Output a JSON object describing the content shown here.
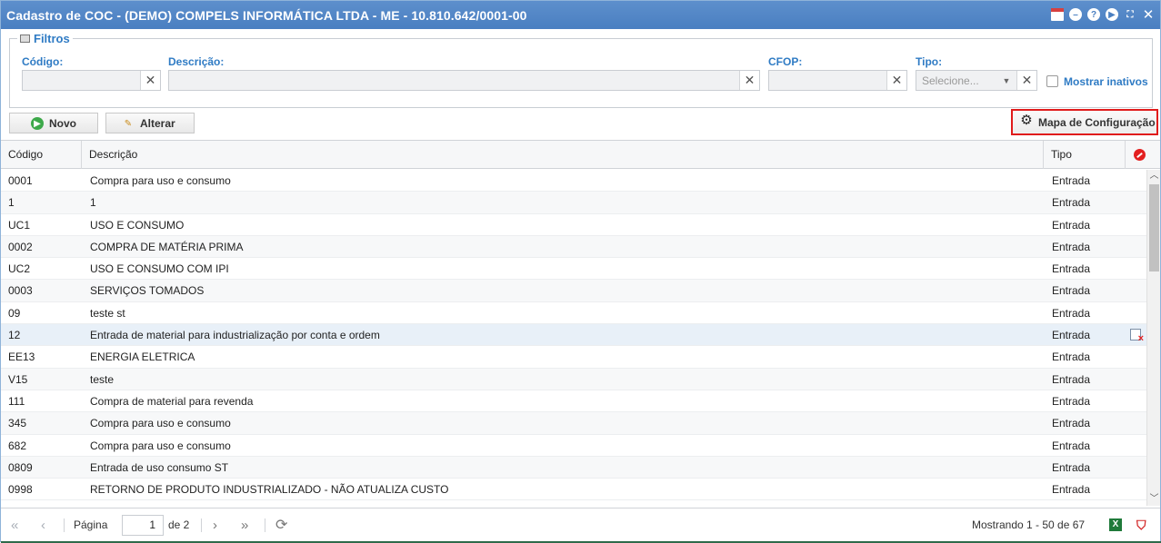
{
  "window": {
    "title": "Cadastro de COC - (DEMO) COMPELS INFORMÁTICA LTDA - ME - 10.810.642/0001-00"
  },
  "filters": {
    "legend": "Filtros",
    "codigo_label": "Código:",
    "codigo_value": "",
    "descricao_label": "Descrição:",
    "descricao_value": "",
    "cfop_label": "CFOP:",
    "cfop_value": "",
    "tipo_label": "Tipo:",
    "tipo_placeholder": "Selecione...",
    "mostrar_inativos_label": "Mostrar inativos",
    "mostrar_inativos_checked": false
  },
  "toolbar": {
    "novo_label": "Novo",
    "alterar_label": "Alterar",
    "mapa_label": "Mapa de Configuração"
  },
  "grid": {
    "columns": [
      "Código",
      "Descrição",
      "Tipo"
    ],
    "rows": [
      {
        "codigo": "0001",
        "descricao": "Compra para uso e consumo",
        "tipo": "Entrada"
      },
      {
        "codigo": "1",
        "descricao": "1",
        "tipo": "Entrada"
      },
      {
        "codigo": "UC1",
        "descricao": "USO E CONSUMO",
        "tipo": "Entrada"
      },
      {
        "codigo": "0002",
        "descricao": "COMPRA DE MATÉRIA PRIMA",
        "tipo": "Entrada"
      },
      {
        "codigo": "UC2",
        "descricao": "USO E CONSUMO COM IPI",
        "tipo": "Entrada"
      },
      {
        "codigo": "0003",
        "descricao": "SERVIÇOS TOMADOS",
        "tipo": "Entrada"
      },
      {
        "codigo": "09",
        "descricao": "teste st",
        "tipo": "Entrada"
      },
      {
        "codigo": "12",
        "descricao": "Entrada de material para industrialização por conta e ordem",
        "tipo": "Entrada"
      },
      {
        "codigo": "EE13",
        "descricao": "ENERGIA ELETRICA",
        "tipo": "Entrada"
      },
      {
        "codigo": "V15",
        "descricao": "teste",
        "tipo": "Entrada"
      },
      {
        "codigo": "111",
        "descricao": "Compra de material para revenda",
        "tipo": "Entrada"
      },
      {
        "codigo": "345",
        "descricao": "Compra para uso e consumo",
        "tipo": "Entrada"
      },
      {
        "codigo": "682",
        "descricao": "Compra para uso e consumo",
        "tipo": "Entrada"
      },
      {
        "codigo": "0809",
        "descricao": "Entrada de uso consumo ST",
        "tipo": "Entrada"
      },
      {
        "codigo": "0998",
        "descricao": "RETORNO DE PRODUTO INDUSTRIALIZADO - NÃO ATUALIZA CUSTO",
        "tipo": "Entrada"
      }
    ]
  },
  "pager": {
    "pagina_label": "Página",
    "page_value": "1",
    "de_label": "de 2",
    "status": "Mostrando 1 - 50 de 67"
  }
}
